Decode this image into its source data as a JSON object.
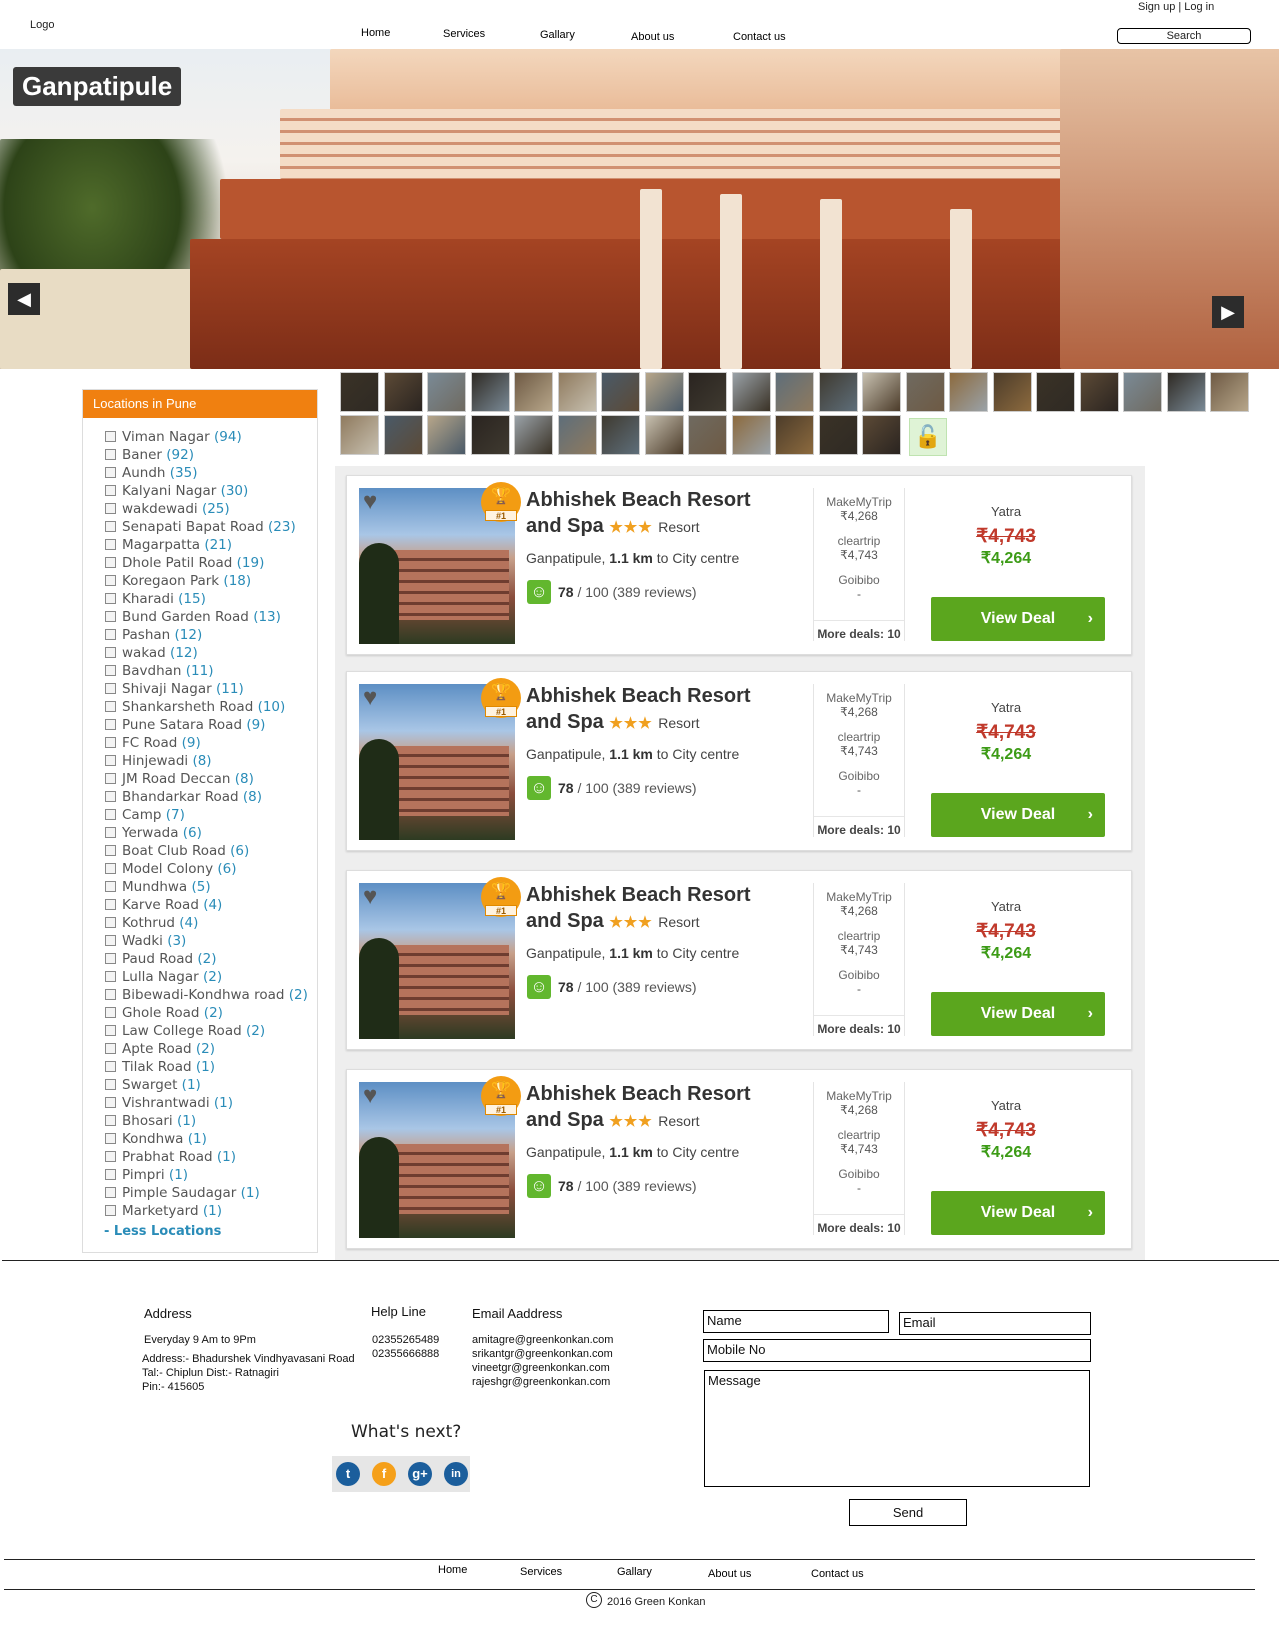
{
  "header": {
    "logo": "Logo",
    "nav": [
      "Home",
      "Services",
      "Gallary",
      "About us",
      "Contact us"
    ],
    "auth": "Sign up | Log in",
    "search": "Search"
  },
  "hero": {
    "title": "Ganpatipule",
    "prev": "◀",
    "next": "▶"
  },
  "sidebar": {
    "title": "Locations in Pune",
    "locations": [
      {
        "name": "Viman Nagar",
        "count": "(94)"
      },
      {
        "name": "Baner",
        "count": "(92)"
      },
      {
        "name": "Aundh",
        "count": "(35)"
      },
      {
        "name": "Kalyani Nagar",
        "count": "(30)"
      },
      {
        "name": "wakdewadi",
        "count": "(25)"
      },
      {
        "name": "Senapati Bapat Road",
        "count": "(23)"
      },
      {
        "name": "Magarpatta",
        "count": "(21)"
      },
      {
        "name": "Dhole Patil Road",
        "count": "(19)"
      },
      {
        "name": "Koregaon Park",
        "count": "(18)"
      },
      {
        "name": "Kharadi",
        "count": "(15)"
      },
      {
        "name": "Bund Garden Road",
        "count": "(13)"
      },
      {
        "name": "Pashan",
        "count": "(12)"
      },
      {
        "name": "wakad",
        "count": "(12)"
      },
      {
        "name": "Bavdhan",
        "count": "(11)"
      },
      {
        "name": "Shivaji Nagar",
        "count": "(11)"
      },
      {
        "name": "Shankarsheth Road",
        "count": "(10)"
      },
      {
        "name": "Pune Satara Road",
        "count": "(9)"
      },
      {
        "name": "FC Road",
        "count": "(9)"
      },
      {
        "name": "Hinjewadi",
        "count": "(8)"
      },
      {
        "name": "JM Road Deccan",
        "count": "(8)"
      },
      {
        "name": "Bhandarkar Road",
        "count": "(8)"
      },
      {
        "name": "Camp",
        "count": "(7)"
      },
      {
        "name": "Yerwada",
        "count": "(6)"
      },
      {
        "name": "Boat Club Road",
        "count": "(6)"
      },
      {
        "name": "Model Colony",
        "count": "(6)"
      },
      {
        "name": "Mundhwa",
        "count": "(5)"
      },
      {
        "name": "Karve Road",
        "count": "(4)"
      },
      {
        "name": "Kothrud",
        "count": "(4)"
      },
      {
        "name": "Wadki",
        "count": "(3)"
      },
      {
        "name": "Paud Road",
        "count": "(2)"
      },
      {
        "name": "Lulla Nagar",
        "count": "(2)"
      },
      {
        "name": "Bibewadi-Kondhwa road",
        "count": "(2)"
      },
      {
        "name": "Ghole Road",
        "count": "(2)"
      },
      {
        "name": "Law College Road",
        "count": "(2)"
      },
      {
        "name": "Apte Road",
        "count": "(2)"
      },
      {
        "name": "Tilak Road",
        "count": "(1)"
      },
      {
        "name": "Swarget",
        "count": "(1)"
      },
      {
        "name": "Vishrantwadi",
        "count": "(1)"
      },
      {
        "name": "Bhosari",
        "count": "(1)"
      },
      {
        "name": "Kondhwa",
        "count": "(1)"
      },
      {
        "name": "Prabhat Road",
        "count": "(1)"
      },
      {
        "name": "Pimpri",
        "count": "(1)"
      },
      {
        "name": "Pimple Saudagar",
        "count": "(1)"
      },
      {
        "name": "Marketyard",
        "count": "(1)"
      }
    ],
    "less": "- Less Locations"
  },
  "hotels": [
    {
      "name": "Abhishek Beach Resort and Spa",
      "stars": "★★★",
      "type": "Resort",
      "rank": "#1",
      "location": "Ganpatipule,",
      "distance": "1.1 km",
      "distance_suffix": "to City centre",
      "score": "78",
      "score_suffix": "/ 100 (389 reviews)",
      "providers": [
        {
          "name": "MakeMyTrip",
          "price": "₹4,268"
        },
        {
          "name": "cleartrip",
          "price": "₹4,743"
        },
        {
          "name": "Goibibo",
          "price": "-"
        }
      ],
      "more": "More deals: 10",
      "best_provider": "Yatra",
      "old_price": "₹4,743",
      "new_price": "₹4,264",
      "cta": "View Deal"
    },
    {
      "name": "Abhishek Beach Resort and Spa",
      "stars": "★★★",
      "type": "Resort",
      "rank": "#1",
      "location": "Ganpatipule,",
      "distance": "1.1 km",
      "distance_suffix": "to City centre",
      "score": "78",
      "score_suffix": "/ 100 (389 reviews)",
      "providers": [
        {
          "name": "MakeMyTrip",
          "price": "₹4,268"
        },
        {
          "name": "cleartrip",
          "price": "₹4,743"
        },
        {
          "name": "Goibibo",
          "price": "-"
        }
      ],
      "more": "More deals: 10",
      "best_provider": "Yatra",
      "old_price": "₹4,743",
      "new_price": "₹4,264",
      "cta": "View Deal"
    },
    {
      "name": "Abhishek Beach Resort and Spa",
      "stars": "★★★",
      "type": "Resort",
      "rank": "#1",
      "location": "Ganpatipule,",
      "distance": "1.1 km",
      "distance_suffix": "to City centre",
      "score": "78",
      "score_suffix": "/ 100 (389 reviews)",
      "providers": [
        {
          "name": "MakeMyTrip",
          "price": "₹4,268"
        },
        {
          "name": "cleartrip",
          "price": "₹4,743"
        },
        {
          "name": "Goibibo",
          "price": "-"
        }
      ],
      "more": "More deals: 10",
      "best_provider": "Yatra",
      "old_price": "₹4,743",
      "new_price": "₹4,264",
      "cta": "View Deal"
    },
    {
      "name": "Abhishek Beach Resort and Spa",
      "stars": "★★★",
      "type": "Resort",
      "rank": "#1",
      "location": "Ganpatipule,",
      "distance": "1.1 km",
      "distance_suffix": "to City centre",
      "score": "78",
      "score_suffix": "/ 100 (389 reviews)",
      "providers": [
        {
          "name": "MakeMyTrip",
          "price": "₹4,268"
        },
        {
          "name": "cleartrip",
          "price": "₹4,743"
        },
        {
          "name": "Goibibo",
          "price": "-"
        }
      ],
      "more": "More deals: 10",
      "best_provider": "Yatra",
      "old_price": "₹4,743",
      "new_price": "₹4,264",
      "cta": "View Deal"
    }
  ],
  "footer": {
    "address_title": "Address",
    "hours": "Everyday 9 Am to 9Pm",
    "address_lines": [
      "Address:- Bhadurshek Vindhyavasani Road",
      "Tal:- Chiplun Dist:- Ratnagiri",
      "Pin:- 415605"
    ],
    "helpline_title": "Help Line",
    "phones": [
      "02355265489",
      "02355666888"
    ],
    "email_title": "Email Aaddress",
    "emails": [
      "amitagre@greenkonkan.com",
      "srikantgr@greenkonkan.com",
      "vineetgr@greenkonkan.com",
      "rajeshgr@greenkonkan.com"
    ],
    "whats_next": "What's next?",
    "form": {
      "name": "Name",
      "email": "Email",
      "mobile": "Mobile No",
      "message": "Message",
      "send": "Send"
    },
    "nav": [
      "Home",
      "Services",
      "Gallary",
      "About us",
      "Contact us"
    ],
    "copyright": "2016 Green Konkan"
  },
  "colors": {
    "accent": "#f08010",
    "cta": "#5ba61e",
    "link": "#2a8cb8",
    "old_price": "#c0392b",
    "new_price": "#3c9b16"
  }
}
